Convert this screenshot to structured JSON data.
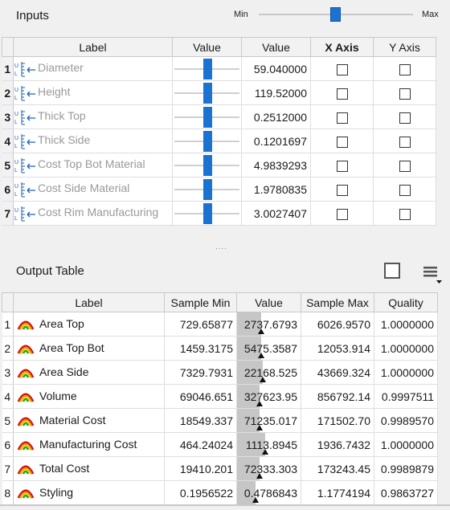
{
  "inputs": {
    "title": "Inputs",
    "slider_min": "Min",
    "slider_max": "Max",
    "columns": [
      "Label",
      "Value",
      "Value",
      "X Axis",
      "Y Axis"
    ],
    "rows": [
      {
        "num": "1",
        "label": "Diameter",
        "value": "59.040000",
        "slider": 0.5
      },
      {
        "num": "2",
        "label": "Height",
        "value": "119.52000",
        "slider": 0.5
      },
      {
        "num": "3",
        "label": "Thick Top",
        "value": "0.2512000",
        "slider": 0.5
      },
      {
        "num": "4",
        "label": "Thick Side",
        "value": "0.1201697",
        "slider": 0.5
      },
      {
        "num": "5",
        "label": "Cost Top Bot Material",
        "value": "4.9839293",
        "slider": 0.5
      },
      {
        "num": "6",
        "label": "Cost Side Material",
        "value": "1.9780835",
        "slider": 0.5
      },
      {
        "num": "7",
        "label": "Cost Rim Manufacturing",
        "value": "3.0027407",
        "slider": 0.5
      }
    ]
  },
  "splitter": "....",
  "output": {
    "title": "Output Table",
    "columns": [
      "Label",
      "Sample Min",
      "Value",
      "Sample Max",
      "Quality"
    ],
    "rows": [
      {
        "num": "1",
        "label": "Area Top",
        "min": "729.65877",
        "value": "2737.6793",
        "max": "6026.9570",
        "quality": "1.0000000",
        "fill": 0.38
      },
      {
        "num": "2",
        "label": "Area Top Bot",
        "min": "1459.3175",
        "value": "5475.3587",
        "max": "12053.914",
        "quality": "1.0000000",
        "fill": 0.38
      },
      {
        "num": "3",
        "label": "Area Side",
        "min": "7329.7931",
        "value": "22168.525",
        "max": "43669.324",
        "quality": "1.0000000",
        "fill": 0.41
      },
      {
        "num": "4",
        "label": "Volume",
        "min": "69046.651",
        "value": "327623.95",
        "max": "856792.14",
        "quality": "0.9997511",
        "fill": 0.35
      },
      {
        "num": "5",
        "label": "Material Cost",
        "min": "18549.337",
        "value": "71235.017",
        "max": "171502.70",
        "quality": "0.9989570",
        "fill": 0.35
      },
      {
        "num": "6",
        "label": "Manufacturing Cost",
        "min": "464.24024",
        "value": "1113.8945",
        "max": "1936.7432",
        "quality": "1.0000000",
        "fill": 0.44
      },
      {
        "num": "7",
        "label": "Total Cost",
        "min": "19410.201",
        "value": "72333.303",
        "max": "173243.45",
        "quality": "0.9989879",
        "fill": 0.35
      },
      {
        "num": "8",
        "label": "Styling",
        "min": "0.1956522",
        "value": "0.4786843",
        "max": "1.1774194",
        "quality": "0.9863727",
        "fill": 0.29
      }
    ]
  }
}
